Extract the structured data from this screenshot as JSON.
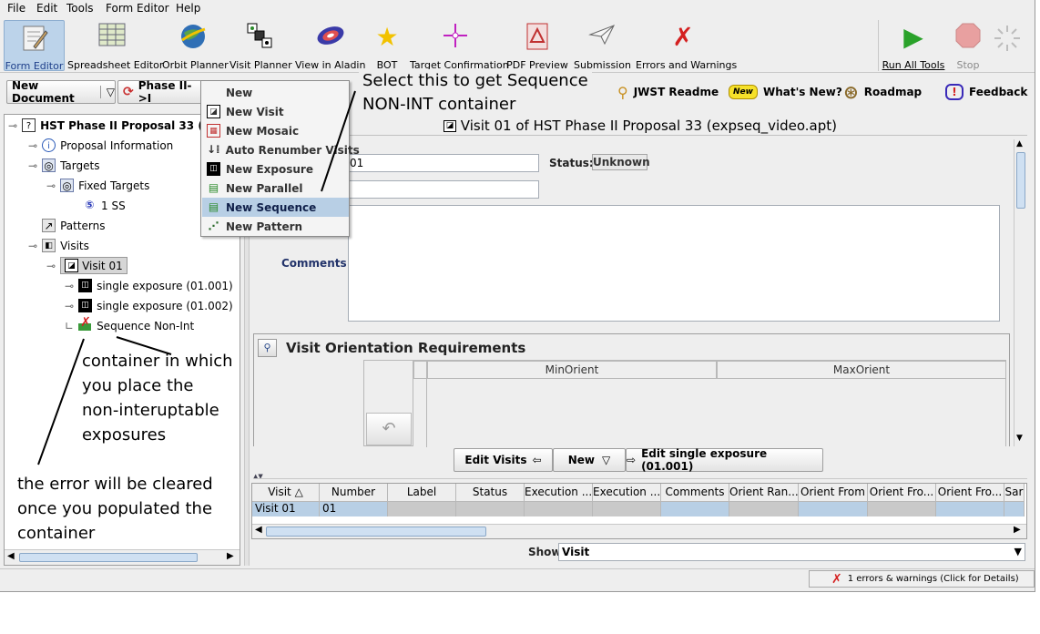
{
  "menubar": {
    "items": [
      "File",
      "Edit",
      "Tools",
      "Form Editor",
      "Help"
    ]
  },
  "toolbar": {
    "tools": [
      {
        "label": "Form Editor",
        "icon": "form-editor-icon"
      },
      {
        "label": "Spreadsheet Editor",
        "icon": "spreadsheet-icon"
      },
      {
        "label": "Orbit Planner",
        "icon": "orbit-planner-icon"
      },
      {
        "label": "Visit Planner",
        "icon": "visit-planner-icon"
      },
      {
        "label": "View in Aladin",
        "icon": "aladin-icon"
      },
      {
        "label": "BOT",
        "icon": "bot-star-icon"
      },
      {
        "label": "Target Confirmation",
        "icon": "target-icon"
      },
      {
        "label": "PDF Preview",
        "icon": "pdf-icon"
      },
      {
        "label": "Submission",
        "icon": "submission-icon"
      },
      {
        "label": "Errors and Warnings",
        "icon": "error-x-icon"
      }
    ],
    "run_all": "Run All Tools",
    "stop": "Stop"
  },
  "subbar": {
    "new_document": "New Document",
    "phase": "Phase II->I",
    "jwst_readme": "JWST Readme",
    "whats_new": "What's New?",
    "whats_new_badge": "New",
    "roadmap": "Roadmap",
    "feedback": "Feedback"
  },
  "tree": {
    "root": "HST Phase II Proposal 33 (exps",
    "proposal_info": "Proposal Information",
    "targets": "Targets",
    "fixed_targets": "Fixed Targets",
    "target_1": "1 SS",
    "patterns": "Patterns",
    "visits": "Visits",
    "visit_01": "Visit 01",
    "exp_1": "single exposure (01.001)",
    "exp_2": "single exposure (01.002)",
    "sequence": "Sequence Non-Int"
  },
  "popup_menu": {
    "items": [
      {
        "label": "New",
        "icon": ""
      },
      {
        "label": "New Visit",
        "icon": "visit-icon"
      },
      {
        "label": "New Mosaic",
        "icon": "mosaic-icon"
      },
      {
        "label": "Auto Renumber Visits",
        "icon": "renumber-icon"
      },
      {
        "label": "New Exposure",
        "icon": "exposure-icon"
      },
      {
        "label": "New Parallel",
        "icon": "parallel-icon"
      },
      {
        "label": "New Sequence",
        "icon": "sequence-icon"
      },
      {
        "label": "New Pattern",
        "icon": "pattern-icon"
      }
    ],
    "selected": "New Sequence"
  },
  "editor": {
    "title": "Visit 01 of HST Phase II Proposal 33 (expseq_video.apt)",
    "number_value": "01",
    "status_label": "Status:",
    "status_value": "Unknown",
    "comments_label": "Comments",
    "orientation_title": "Visit Orientation Requirements",
    "min_orient": "MinOrient",
    "max_orient": "MaxOrient",
    "btn_edit_visits": "Edit Visits",
    "btn_new": "New",
    "btn_edit_exposure": "Edit single exposure (01.001)"
  },
  "table": {
    "headers": [
      "Visit △",
      "Number",
      "Label",
      "Status",
      "Execution ...",
      "Execution ...",
      "Comments",
      "Orient Ran...",
      "Orient From",
      "Orient Fro...",
      "Orient Fro...",
      "Sar"
    ],
    "row": [
      "Visit 01",
      "01",
      "",
      "",
      "",
      "",
      "",
      "",
      "",
      "",
      "",
      ""
    ],
    "show_label": "Show:",
    "show_value": "Visit"
  },
  "status_bar": {
    "text": "1 errors & warnings (Click for Details)"
  },
  "annotations": {
    "select_line1": "Select this to get Sequence",
    "select_line2": "NON-INT container",
    "container_line1": "container in which",
    "container_line2": "you place the",
    "container_line3": "non-interuptable",
    "container_line4": "exposures",
    "error_line1": "the error will be cleared",
    "error_line2": "once you populated the",
    "error_line3": "container"
  },
  "colors": {
    "selection": "#b8cfe5",
    "error_red": "#d42020",
    "accent_blue": "#1e3f8a"
  }
}
